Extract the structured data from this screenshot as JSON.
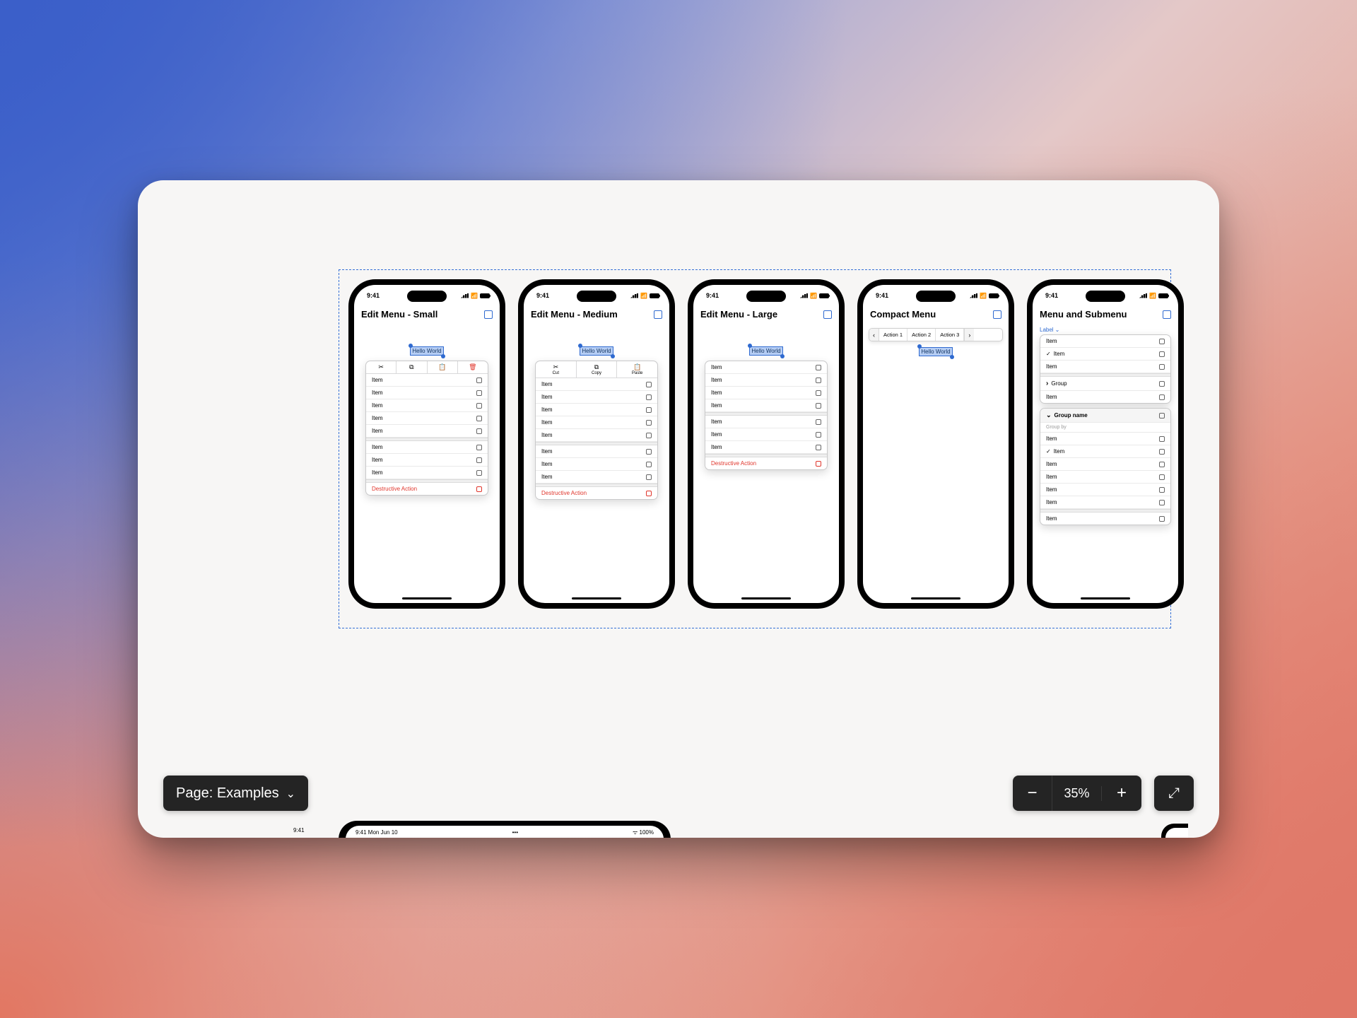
{
  "page_selector_label": "Page: Examples",
  "zoom": "35%",
  "status_time": "9:41",
  "tablet_time": "9:41  Mon Jun 10",
  "tablet_status": "ᯤ 100%",
  "hello": "Hello World",
  "phones": [
    {
      "title": "Edit Menu - Small",
      "toolbar": [
        {
          "icon": "✂",
          "label": ""
        },
        {
          "icon": "⧉",
          "label": ""
        },
        {
          "icon": "📋",
          "label": ""
        },
        {
          "icon": "🗑",
          "label": "",
          "danger": true
        }
      ],
      "items": [
        "Item",
        "Item",
        "Item",
        "Item",
        "Item"
      ],
      "items2": [
        "Item",
        "Item",
        "Item"
      ],
      "destructive": "Destructive Action"
    },
    {
      "title": "Edit Menu - Medium",
      "toolbar": [
        {
          "icon": "✂",
          "label": "Cut"
        },
        {
          "icon": "⧉",
          "label": "Copy"
        },
        {
          "icon": "📋",
          "label": "Paste"
        }
      ],
      "items": [
        "Item",
        "Item",
        "Item",
        "Item",
        "Item"
      ],
      "items2": [
        "Item",
        "Item",
        "Item"
      ],
      "destructive": "Destructive Action"
    },
    {
      "title": "Edit Menu - Large",
      "items": [
        "Item",
        "Item",
        "Item",
        "Item"
      ],
      "items2": [
        "Item",
        "Item",
        "Item"
      ],
      "destructive": "Destructive Action"
    },
    {
      "title": "Compact Menu",
      "actions": [
        "Action 1",
        "Action 2",
        "Action 3"
      ]
    },
    {
      "title": "Menu and Submenu",
      "link": "Label",
      "top_items": [
        "Item",
        "Item",
        "Item"
      ],
      "group": "Group",
      "after_group": [
        "Item"
      ],
      "group_name": "Group name",
      "group_by": "Group by",
      "sub_items": [
        "Item",
        "Item",
        "Item",
        "Item",
        "Item",
        "Item",
        "Item"
      ]
    }
  ]
}
